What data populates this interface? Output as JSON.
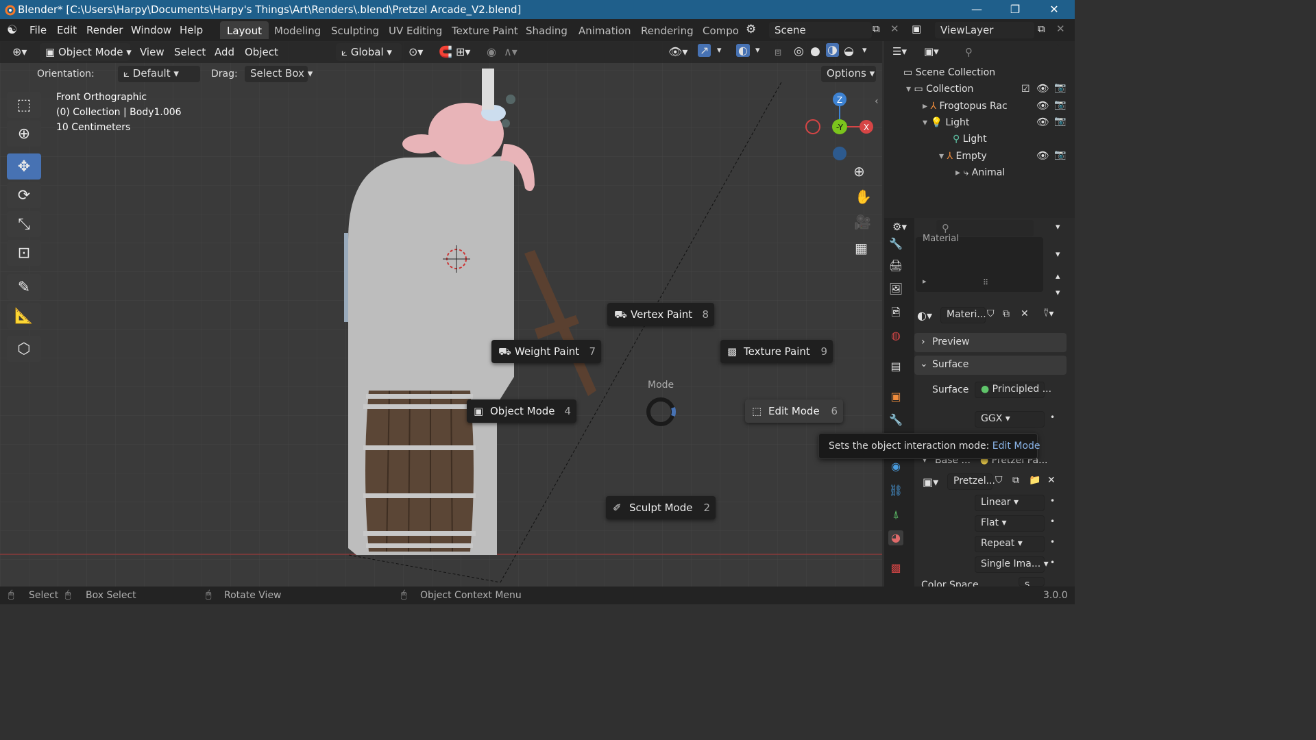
{
  "titlebar": {
    "title": "Blender* [C:\\Users\\Harpy\\Documents\\Harpy's Things\\Art\\Renders\\.blend\\Pretzel Arcade_V2.blend]"
  },
  "menu": {
    "file": "File",
    "edit": "Edit",
    "render": "Render",
    "window": "Window",
    "help": "Help"
  },
  "workspaces": [
    "Layout",
    "Modeling",
    "Sculpting",
    "UV Editing",
    "Texture Paint",
    "Shading",
    "Animation",
    "Rendering",
    "Compo"
  ],
  "scene": {
    "name": "Scene",
    "view_layer": "ViewLayer"
  },
  "viewport_header": {
    "mode": "Object Mode",
    "view": "View",
    "select": "Select",
    "add": "Add",
    "object": "Object",
    "transform": "Global"
  },
  "tool_header": {
    "orientation_label": "Orientation:",
    "orientation_value": "Default",
    "drag_label": "Drag:",
    "drag_value": "Select Box",
    "options": "Options"
  },
  "overlay_text": {
    "view": "Front Orthographic",
    "collection": "(0) Collection | Body1.006",
    "scale": "10 Centimeters"
  },
  "pie_menu": {
    "title": "Mode",
    "items": [
      {
        "label": "Vertex Paint",
        "key": "8"
      },
      {
        "label": "Weight Paint",
        "key": "7"
      },
      {
        "label": "Texture Paint",
        "key": "9"
      },
      {
        "label": "Object Mode",
        "key": "4"
      },
      {
        "label": "Edit Mode",
        "key": "6"
      },
      {
        "label": "Sculpt Mode",
        "key": "2"
      }
    ]
  },
  "tooltip": {
    "text": "Sets the object interaction mode:",
    "value": "Edit Mode"
  },
  "outliner": {
    "scene_collection": "Scene Collection",
    "collection": "Collection",
    "items": [
      {
        "label": "Frogtopus Rac"
      },
      {
        "label": "Light"
      },
      {
        "label": "Light"
      },
      {
        "label": "Empty"
      },
      {
        "label": "Animal"
      }
    ]
  },
  "properties": {
    "material_slot": "Material",
    "material_name": "Materi...",
    "preview": "Preview",
    "surface_header": "Surface",
    "surface_label": "Surface",
    "surface_value": "Principled ...",
    "distribution": "GGX",
    "base_label": "Base ...",
    "base_value": "Pretzel Pa...",
    "image_name": "Pretzel...",
    "interpolation": "Linear",
    "projection": "Flat",
    "extension": "Repeat",
    "source": "Single Ima...",
    "color_space_label": "Color Space",
    "color_space_value": "s"
  },
  "statusbar": {
    "select": "Select",
    "box_select": "Box Select",
    "rotate": "Rotate View",
    "context": "Object Context Menu",
    "version": "3.0.0"
  },
  "gizmo": {
    "z": "Z",
    "y": "-Y",
    "x": "X"
  },
  "colors": {
    "titlebar": "#1f5f8b",
    "accent": "#4772b3",
    "axis_x": "#d64545",
    "axis_y": "#7bc41d",
    "axis_z": "#3d82d2"
  }
}
